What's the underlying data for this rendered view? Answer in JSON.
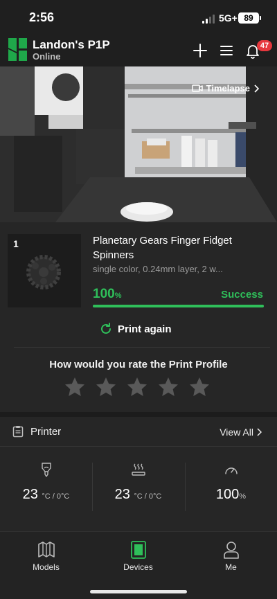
{
  "status_bar": {
    "time": "2:56",
    "network": "5G+",
    "battery": "89"
  },
  "header": {
    "printer_name": "Landon's P1P",
    "printer_status": "Online",
    "notification_count": "47"
  },
  "camera": {
    "timelapse_label": "Timelapse"
  },
  "job": {
    "plate_number": "1",
    "title": "Planetary Gears Finger Fidget Spinners",
    "meta": "single color, 0.24mm layer, 2 w...",
    "progress_value": "100",
    "progress_unit": "%",
    "progress_fraction": 1.0,
    "state": "Success",
    "print_again_label": "Print again",
    "rating_prompt": "How would you rate the Print Profile",
    "rating_stars_total": 5,
    "rating_stars_filled": 0
  },
  "printer_section": {
    "title": "Printer",
    "view_all_label": "View All",
    "nozzle": {
      "value": "23",
      "unit": "°C / 0°C"
    },
    "bed": {
      "value": "23",
      "unit": "°C / 0°C"
    },
    "fan": {
      "value": "100",
      "unit": "%"
    }
  },
  "nav": {
    "models": "Models",
    "devices": "Devices",
    "me": "Me"
  },
  "colors": {
    "accent": "#2fbf5a",
    "badge": "#e6373d",
    "background": "#1c1c1c",
    "card": "#262626"
  },
  "icons": [
    "bambu-logo-icon",
    "plus-icon",
    "menu-icon",
    "bell-icon",
    "timelapse-camera-icon",
    "chevron-right-icon",
    "refresh-icon",
    "star-icon",
    "clipboard-icon",
    "nozzle-icon",
    "heatbed-icon",
    "fan-speed-icon",
    "models-icon",
    "devices-icon",
    "me-icon"
  ]
}
